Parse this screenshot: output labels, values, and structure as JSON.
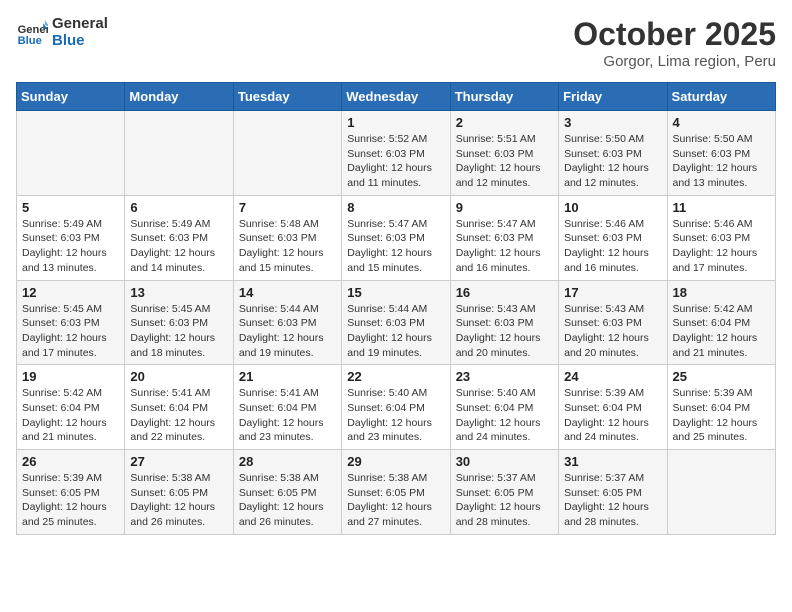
{
  "header": {
    "logo_line1": "General",
    "logo_line2": "Blue",
    "month_year": "October 2025",
    "location": "Gorgor, Lima region, Peru"
  },
  "weekdays": [
    "Sunday",
    "Monday",
    "Tuesday",
    "Wednesday",
    "Thursday",
    "Friday",
    "Saturday"
  ],
  "weeks": [
    [
      {
        "day": "",
        "info": ""
      },
      {
        "day": "",
        "info": ""
      },
      {
        "day": "",
        "info": ""
      },
      {
        "day": "1",
        "info": "Sunrise: 5:52 AM\nSunset: 6:03 PM\nDaylight: 12 hours\nand 11 minutes."
      },
      {
        "day": "2",
        "info": "Sunrise: 5:51 AM\nSunset: 6:03 PM\nDaylight: 12 hours\nand 12 minutes."
      },
      {
        "day": "3",
        "info": "Sunrise: 5:50 AM\nSunset: 6:03 PM\nDaylight: 12 hours\nand 12 minutes."
      },
      {
        "day": "4",
        "info": "Sunrise: 5:50 AM\nSunset: 6:03 PM\nDaylight: 12 hours\nand 13 minutes."
      }
    ],
    [
      {
        "day": "5",
        "info": "Sunrise: 5:49 AM\nSunset: 6:03 PM\nDaylight: 12 hours\nand 13 minutes."
      },
      {
        "day": "6",
        "info": "Sunrise: 5:49 AM\nSunset: 6:03 PM\nDaylight: 12 hours\nand 14 minutes."
      },
      {
        "day": "7",
        "info": "Sunrise: 5:48 AM\nSunset: 6:03 PM\nDaylight: 12 hours\nand 15 minutes."
      },
      {
        "day": "8",
        "info": "Sunrise: 5:47 AM\nSunset: 6:03 PM\nDaylight: 12 hours\nand 15 minutes."
      },
      {
        "day": "9",
        "info": "Sunrise: 5:47 AM\nSunset: 6:03 PM\nDaylight: 12 hours\nand 16 minutes."
      },
      {
        "day": "10",
        "info": "Sunrise: 5:46 AM\nSunset: 6:03 PM\nDaylight: 12 hours\nand 16 minutes."
      },
      {
        "day": "11",
        "info": "Sunrise: 5:46 AM\nSunset: 6:03 PM\nDaylight: 12 hours\nand 17 minutes."
      }
    ],
    [
      {
        "day": "12",
        "info": "Sunrise: 5:45 AM\nSunset: 6:03 PM\nDaylight: 12 hours\nand 17 minutes."
      },
      {
        "day": "13",
        "info": "Sunrise: 5:45 AM\nSunset: 6:03 PM\nDaylight: 12 hours\nand 18 minutes."
      },
      {
        "day": "14",
        "info": "Sunrise: 5:44 AM\nSunset: 6:03 PM\nDaylight: 12 hours\nand 19 minutes."
      },
      {
        "day": "15",
        "info": "Sunrise: 5:44 AM\nSunset: 6:03 PM\nDaylight: 12 hours\nand 19 minutes."
      },
      {
        "day": "16",
        "info": "Sunrise: 5:43 AM\nSunset: 6:03 PM\nDaylight: 12 hours\nand 20 minutes."
      },
      {
        "day": "17",
        "info": "Sunrise: 5:43 AM\nSunset: 6:03 PM\nDaylight: 12 hours\nand 20 minutes."
      },
      {
        "day": "18",
        "info": "Sunrise: 5:42 AM\nSunset: 6:04 PM\nDaylight: 12 hours\nand 21 minutes."
      }
    ],
    [
      {
        "day": "19",
        "info": "Sunrise: 5:42 AM\nSunset: 6:04 PM\nDaylight: 12 hours\nand 21 minutes."
      },
      {
        "day": "20",
        "info": "Sunrise: 5:41 AM\nSunset: 6:04 PM\nDaylight: 12 hours\nand 22 minutes."
      },
      {
        "day": "21",
        "info": "Sunrise: 5:41 AM\nSunset: 6:04 PM\nDaylight: 12 hours\nand 23 minutes."
      },
      {
        "day": "22",
        "info": "Sunrise: 5:40 AM\nSunset: 6:04 PM\nDaylight: 12 hours\nand 23 minutes."
      },
      {
        "day": "23",
        "info": "Sunrise: 5:40 AM\nSunset: 6:04 PM\nDaylight: 12 hours\nand 24 minutes."
      },
      {
        "day": "24",
        "info": "Sunrise: 5:39 AM\nSunset: 6:04 PM\nDaylight: 12 hours\nand 24 minutes."
      },
      {
        "day": "25",
        "info": "Sunrise: 5:39 AM\nSunset: 6:04 PM\nDaylight: 12 hours\nand 25 minutes."
      }
    ],
    [
      {
        "day": "26",
        "info": "Sunrise: 5:39 AM\nSunset: 6:05 PM\nDaylight: 12 hours\nand 25 minutes."
      },
      {
        "day": "27",
        "info": "Sunrise: 5:38 AM\nSunset: 6:05 PM\nDaylight: 12 hours\nand 26 minutes."
      },
      {
        "day": "28",
        "info": "Sunrise: 5:38 AM\nSunset: 6:05 PM\nDaylight: 12 hours\nand 26 minutes."
      },
      {
        "day": "29",
        "info": "Sunrise: 5:38 AM\nSunset: 6:05 PM\nDaylight: 12 hours\nand 27 minutes."
      },
      {
        "day": "30",
        "info": "Sunrise: 5:37 AM\nSunset: 6:05 PM\nDaylight: 12 hours\nand 28 minutes."
      },
      {
        "day": "31",
        "info": "Sunrise: 5:37 AM\nSunset: 6:05 PM\nDaylight: 12 hours\nand 28 minutes."
      },
      {
        "day": "",
        "info": ""
      }
    ]
  ]
}
